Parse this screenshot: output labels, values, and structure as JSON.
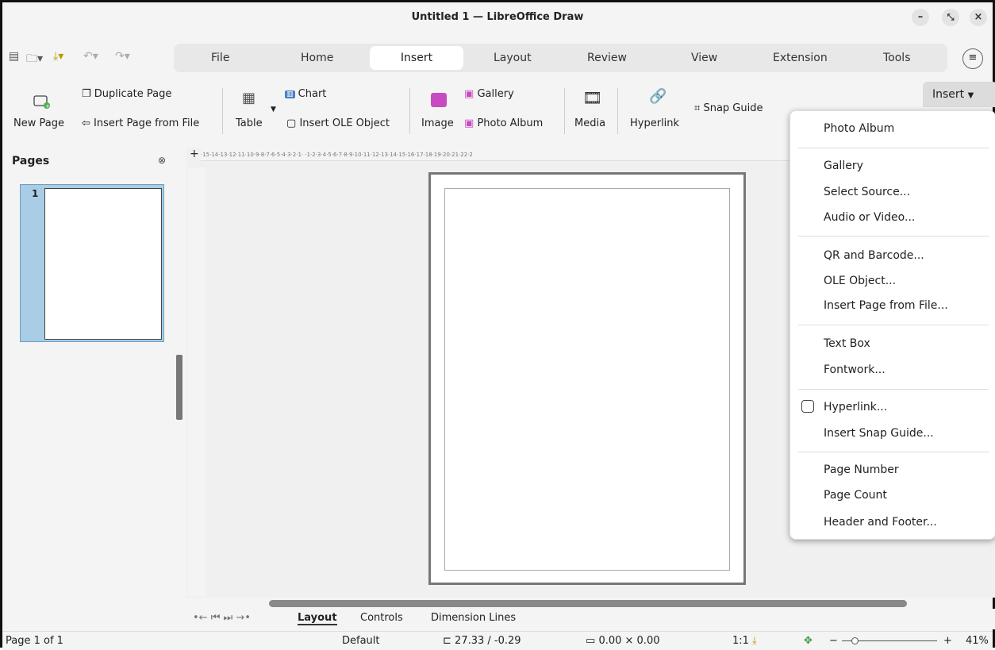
{
  "window": {
    "title": "Untitled 1 — LibreOffice Draw"
  },
  "tabs": [
    "File",
    "Home",
    "Insert",
    "Layout",
    "Review",
    "View",
    "Extension",
    "Tools"
  ],
  "active_tab": "Insert",
  "ribbon": {
    "new_page": "New Page",
    "duplicate_page": "Duplicate Page",
    "insert_page_from_file": "Insert Page from File",
    "table": "Table",
    "chart": "Chart",
    "insert_ole_object": "Insert OLE Object",
    "image": "Image",
    "gallery": "Gallery",
    "photo_album": "Photo Album",
    "media": "Media",
    "hyperlink": "Hyperlink",
    "snap_guide": "Snap Guide",
    "insert_button": "Insert"
  },
  "sidebar": {
    "title": "Pages",
    "page_number": "1"
  },
  "ruler": {
    "h_ticks": "·15·14·13·12·11·10·9·8·7·6·5·4·3·2·1·  ·1·2·3·4·5·6·7·8·9·10·11·12·13·14·15·16·17·18·19·20·21·22·2"
  },
  "dropdown": {
    "items": [
      "Photo Album",
      "Gallery",
      "Select Source...",
      "Audio or Video...",
      "QR and Barcode...",
      "OLE Object...",
      "Insert Page from File...",
      "Text Box",
      "Fontwork...",
      "Hyperlink...",
      "Insert Snap Guide...",
      "Page Number",
      "Page Count",
      "Header and Footer..."
    ]
  },
  "layout_tabs": {
    "layout": "Layout",
    "controls": "Controls",
    "dimension_lines": "Dimension Lines"
  },
  "status": {
    "page": "Page 1 of 1",
    "master": "Default",
    "position": "27.33 / -0.29",
    "size": "0.00 × 0.00",
    "scale": "1:1",
    "zoom": "41%"
  }
}
